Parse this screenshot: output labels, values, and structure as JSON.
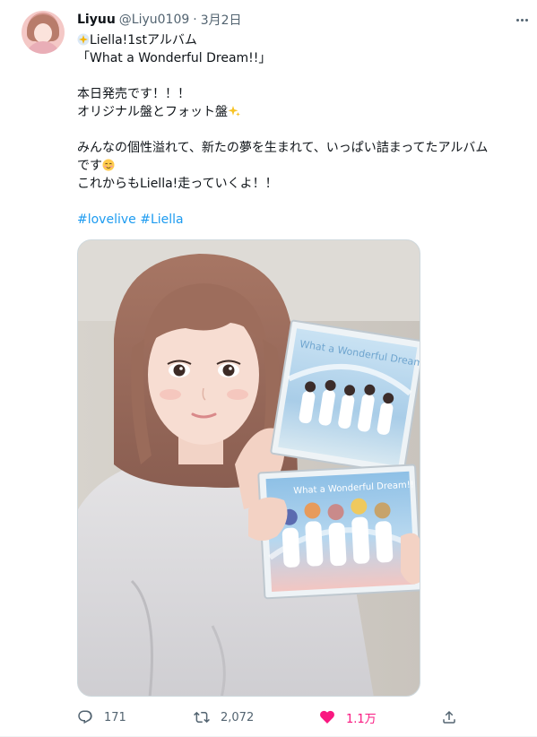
{
  "tweet": {
    "author_name": "Liyuu",
    "handle": "@Liyu0109",
    "separator": "·",
    "date": "3月2日",
    "lines": {
      "l1": "Liella!1stアルバム",
      "l2": "「What a Wonderful Dream!!」",
      "l3": "本日発売です！！！",
      "l4": "オリジナル盤とフォット盤",
      "l5": "みんなの個性溢れて、新たの夢を生まれて、いっぱい詰まってたアルバム",
      "l6": "です",
      "l7": "これからもLiella!走っていくよ！！"
    },
    "hashtags": [
      "#lovelive",
      "#Liella"
    ],
    "media": {
      "cd_top_title": "What a Wonderful Dream!!",
      "cd_bottom_title": "What a Wonderful Dream!!"
    },
    "actions": {
      "reply_count": "171",
      "retweet_count": "2,072",
      "like_count": "1.1万",
      "liked": true
    }
  },
  "icons": [
    "more-icon",
    "sparkle-emoji-icon",
    "sparkles-emoji-icon",
    "smiling-emoji-icon",
    "reply-icon",
    "retweet-icon",
    "heart-icon",
    "share-icon"
  ],
  "colors": {
    "text": "#0f1419",
    "secondary": "#536471",
    "link": "#1d9bf0",
    "like": "#f91880"
  }
}
